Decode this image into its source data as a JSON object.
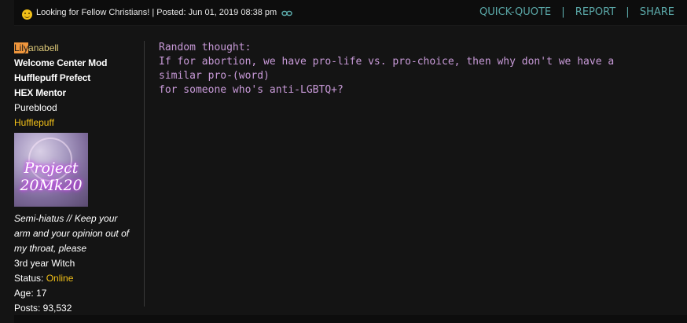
{
  "post": {
    "title": "Looking for Fellow Christians!",
    "posted_label": "Posted:",
    "posted_date": "Jun 01, 2019 08:38 pm",
    "actions": [
      "QUICK-QUOTE",
      "REPORT",
      "SHARE"
    ],
    "icons": [
      "smiley-icon",
      "link-icon"
    ]
  },
  "author": {
    "name_highlight": "Lily",
    "name_rest": "anabell",
    "roles": [
      "Welcome Center Mod",
      "Hufflepuff Prefect",
      "HEX Mentor"
    ],
    "blood": "Pureblood",
    "house": "Hufflepuff",
    "avatar_text_line1": "Project",
    "avatar_text_line2": "20Mk20",
    "tagline": "Semi-hiatus // Keep your arm and your opinion out of my throat, please",
    "year": "3rd year Witch",
    "status_label": "Status: ",
    "status_value": "Online",
    "age": "Age: 17",
    "posts": "Posts: 93,532"
  },
  "message": {
    "line1": "Random thought:",
    "line2": "If for abortion, we have pro-life vs. pro-choice, then why don't we have a similar pro-(word)",
    "line3": "for someone who's anti-LGBTQ+?"
  },
  "colors": {
    "accent": "#5ba9a9",
    "message_text": "#c89ad8",
    "house": "#f2c018",
    "name_highlight_bg": "#f0963c"
  }
}
